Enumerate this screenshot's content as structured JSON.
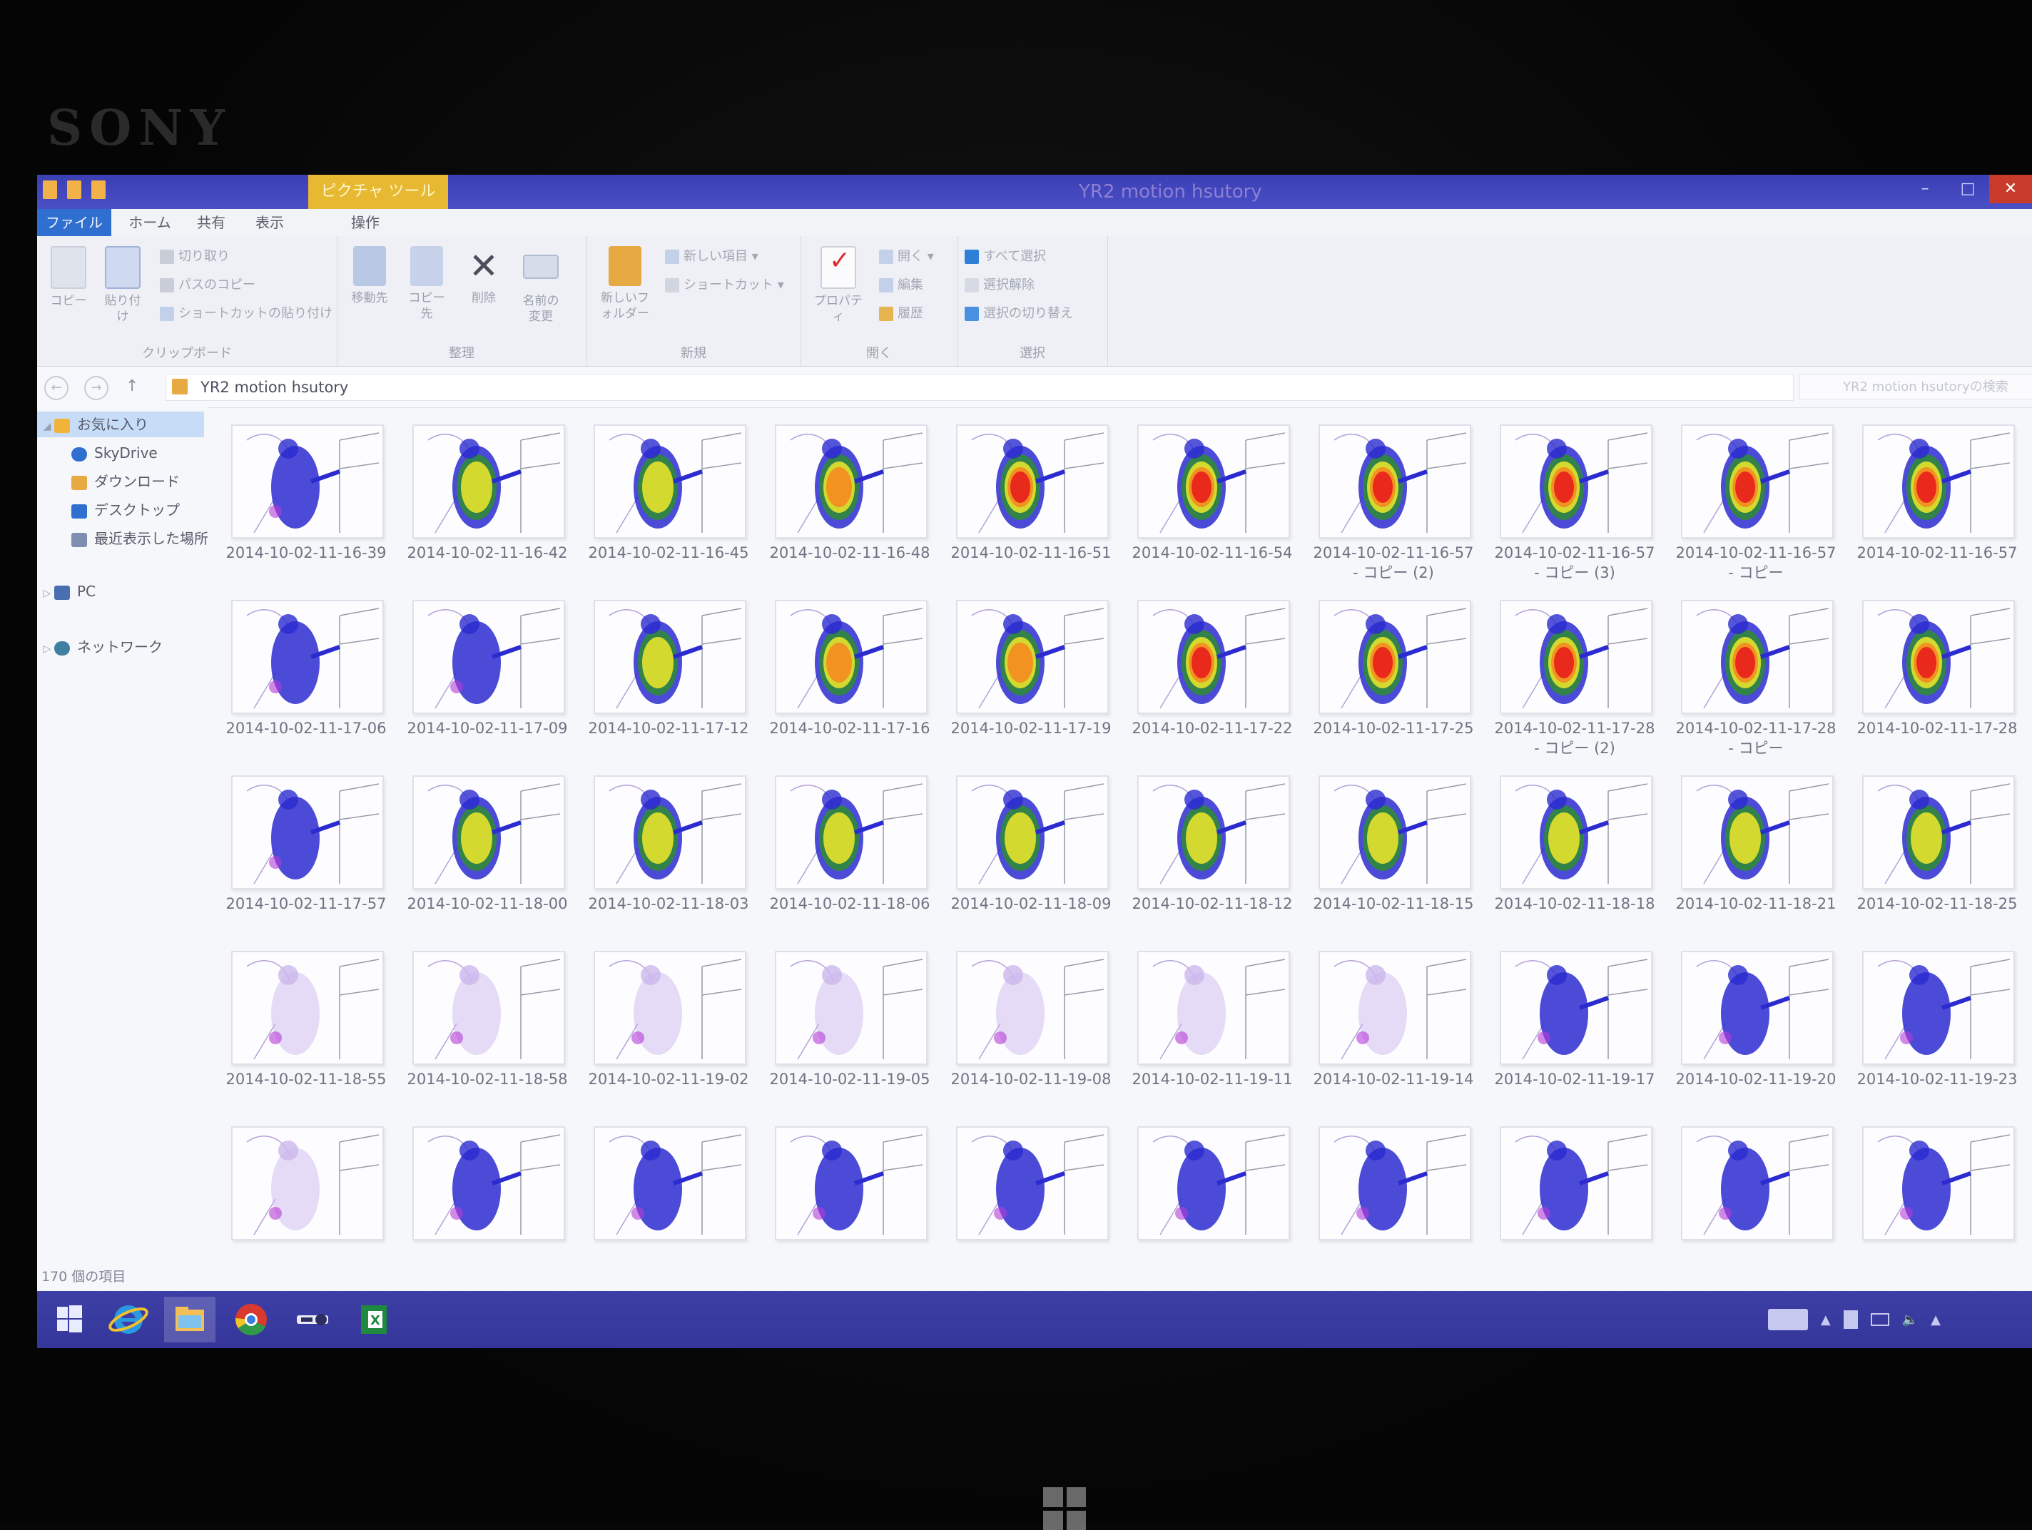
{
  "device": {
    "brand": "SONY"
  },
  "window": {
    "title": "YR2 motion hsutory",
    "contextual_tab": "ピクチャ ツール",
    "controls": {
      "minimize": "–",
      "maximize": "□",
      "close": "✕"
    }
  },
  "tabs": [
    {
      "label": "ファイル"
    },
    {
      "label": "ホーム"
    },
    {
      "label": "共有"
    },
    {
      "label": "表示"
    },
    {
      "label": "操作"
    }
  ],
  "ribbon": {
    "groups": [
      {
        "name": "クリップボード",
        "big": [
          "コピー",
          "貼り付け"
        ],
        "small": [
          "切り取り",
          "パスのコピー",
          "ショートカットの貼り付け"
        ]
      },
      {
        "name": "整理",
        "big": [
          "移動先",
          "コピー先",
          "削除",
          "名前の変更"
        ]
      },
      {
        "name": "新規",
        "big": [
          "新しいフォルダー"
        ],
        "small": [
          "新しい項目 ▾",
          "ショートカット ▾"
        ]
      },
      {
        "name": "開く",
        "big": [
          "プロパティ"
        ],
        "small": [
          "開く ▾",
          "編集",
          "履歴"
        ]
      },
      {
        "name": "選択",
        "small": [
          "すべて選択",
          "選択解除",
          "選択の切り替え"
        ]
      }
    ]
  },
  "address": {
    "path": "YR2 motion hsutory",
    "search_placeholder": "YR2 motion hsutoryの検索"
  },
  "nav": [
    {
      "label": "お気に入り",
      "icon": "star-icon",
      "color": "#f0b43a",
      "level": 0,
      "expanded": true,
      "selected": true
    },
    {
      "label": "SkyDrive",
      "icon": "cloud-icon",
      "color": "#2f6fd0",
      "level": 1
    },
    {
      "label": "ダウンロード",
      "icon": "download-folder-icon",
      "color": "#e7a942",
      "level": 1
    },
    {
      "label": "デスクトップ",
      "icon": "desktop-icon",
      "color": "#2f6fd0",
      "level": 1
    },
    {
      "label": "最近表示した場所",
      "icon": "recent-places-icon",
      "color": "#7d8fb0",
      "level": 1
    },
    {
      "label": "PC",
      "icon": "pc-icon",
      "color": "#4a6fb0",
      "level": 0
    },
    {
      "label": "ネットワーク",
      "icon": "network-icon",
      "color": "#3f7fa0",
      "level": 0
    }
  ],
  "files": {
    "rows": [
      {
        "row": 1,
        "items": [
          {
            "name": "2014-10-02-11-16-39",
            "intensity": 1
          },
          {
            "name": "2014-10-02-11-16-42",
            "intensity": 2
          },
          {
            "name": "2014-10-02-11-16-45",
            "intensity": 2
          },
          {
            "name": "2014-10-02-11-16-48",
            "intensity": 3
          },
          {
            "name": "2014-10-02-11-16-51",
            "intensity": 4
          },
          {
            "name": "2014-10-02-11-16-54",
            "intensity": 4
          },
          {
            "name": "2014-10-02-11-16-57 - コピー (2)",
            "intensity": 4
          },
          {
            "name": "2014-10-02-11-16-57 - コピー (3)",
            "intensity": 4
          },
          {
            "name": "2014-10-02-11-16-57 - コピー",
            "intensity": 4
          },
          {
            "name": "2014-10-02-11-16-57",
            "intensity": 4
          }
        ]
      },
      {
        "row": 2,
        "items": [
          {
            "name": "2014-10-02-11-17-06",
            "intensity": 1
          },
          {
            "name": "2014-10-02-11-17-09",
            "intensity": 1
          },
          {
            "name": "2014-10-02-11-17-12",
            "intensity": 2
          },
          {
            "name": "2014-10-02-11-17-16",
            "intensity": 3
          },
          {
            "name": "2014-10-02-11-17-19",
            "intensity": 3
          },
          {
            "name": "2014-10-02-11-17-22",
            "intensity": 4
          },
          {
            "name": "2014-10-02-11-17-25",
            "intensity": 4
          },
          {
            "name": "2014-10-02-11-17-28 - コピー (2)",
            "intensity": 4
          },
          {
            "name": "2014-10-02-11-17-28 - コピー",
            "intensity": 4
          },
          {
            "name": "2014-10-02-11-17-28",
            "intensity": 4
          }
        ]
      },
      {
        "row": 3,
        "items": [
          {
            "name": "2014-10-02-11-17-57",
            "intensity": 1
          },
          {
            "name": "2014-10-02-11-18-00",
            "intensity": 2
          },
          {
            "name": "2014-10-02-11-18-03",
            "intensity": 2
          },
          {
            "name": "2014-10-02-11-18-06",
            "intensity": 2
          },
          {
            "name": "2014-10-02-11-18-09",
            "intensity": 2
          },
          {
            "name": "2014-10-02-11-18-12",
            "intensity": 2
          },
          {
            "name": "2014-10-02-11-18-15",
            "intensity": 2
          },
          {
            "name": "2014-10-02-11-18-18",
            "intensity": 2
          },
          {
            "name": "2014-10-02-11-18-21",
            "intensity": 2
          },
          {
            "name": "2014-10-02-11-18-25",
            "intensity": 2
          }
        ]
      },
      {
        "row": 4,
        "items": [
          {
            "name": "2014-10-02-11-18-55",
            "intensity": 0
          },
          {
            "name": "2014-10-02-11-18-58",
            "intensity": 0
          },
          {
            "name": "2014-10-02-11-19-02",
            "intensity": 0
          },
          {
            "name": "2014-10-02-11-19-05",
            "intensity": 0
          },
          {
            "name": "2014-10-02-11-19-08",
            "intensity": 0
          },
          {
            "name": "2014-10-02-11-19-11",
            "intensity": 0
          },
          {
            "name": "2014-10-02-11-19-14",
            "intensity": 0
          },
          {
            "name": "2014-10-02-11-19-17",
            "intensity": 1
          },
          {
            "name": "2014-10-02-11-19-20",
            "intensity": 1
          },
          {
            "name": "2014-10-02-11-19-23",
            "intensity": 1
          }
        ]
      },
      {
        "row": 5,
        "items": [
          {
            "intensity": 0
          },
          {
            "intensity": 1
          },
          {
            "intensity": 1
          },
          {
            "intensity": 1
          },
          {
            "intensity": 1
          },
          {
            "intensity": 1
          },
          {
            "intensity": 1
          },
          {
            "intensity": 1
          },
          {
            "intensity": 1
          },
          {
            "intensity": 1
          }
        ]
      }
    ]
  },
  "status": {
    "item_count": "170 個の項目"
  },
  "taskbar": {
    "apps": [
      {
        "icon": "windows-start-icon"
      },
      {
        "icon": "internet-explorer-icon"
      },
      {
        "icon": "file-explorer-icon",
        "active": true
      },
      {
        "icon": "chrome-icon"
      },
      {
        "icon": "key-app-icon"
      },
      {
        "icon": "excel-icon"
      }
    ],
    "tray": [
      "keyboard-icon",
      "chevron-up-icon",
      "flag-icon",
      "battery-icon",
      "volume-icon",
      "network-icon"
    ]
  },
  "colors": {
    "heat": [
      "#2b2bd0",
      "#2f8a3a",
      "#e6e22b",
      "#f58a1f",
      "#e8241c",
      "#b43ad6"
    ]
  }
}
